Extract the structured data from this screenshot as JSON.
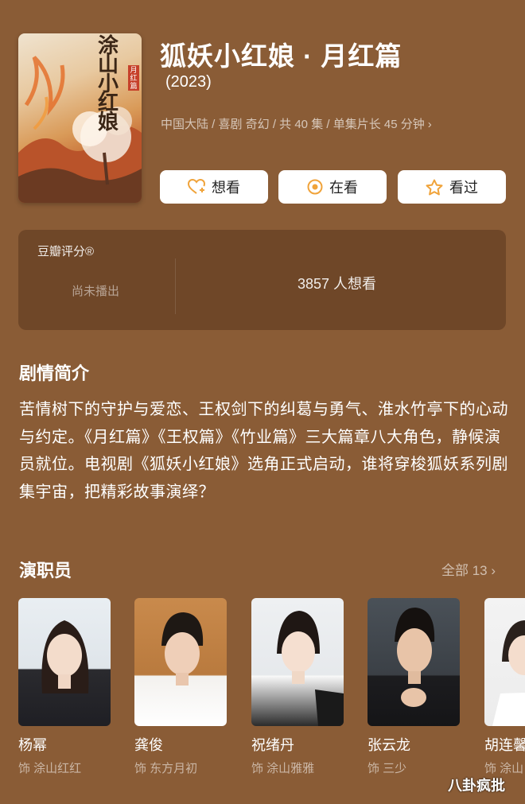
{
  "poster": {
    "calligraphy": "涂山小红娘",
    "seal": "月红篇"
  },
  "header": {
    "title": "狐妖小红娘 · 月红篇",
    "year": "(2023)",
    "meta": "中国大陆 / 喜剧 奇幻 / 共 40 集 / 单集片长 45 分钟"
  },
  "actions": {
    "want_label": "想看",
    "watching_label": "在看",
    "watched_label": "看过"
  },
  "rating": {
    "title": "豆瓣评分®",
    "status": "尚未播出",
    "want_count": "3857 人想看"
  },
  "synopsis": {
    "heading": "剧情简介",
    "text": "苦情树下的守护与爱恋、王权剑下的纠葛与勇气、淮水竹亭下的心动与约定。《月红篇》《王权篇》《竹业篇》三大篇章八大角色，静候演员就位。电视剧《狐妖小红娘》选角正式启动，谁将穿梭狐妖系列剧集宇宙，把精彩故事演绎？"
  },
  "cast": {
    "heading": "演职员",
    "all_label": "全部 13",
    "members": [
      {
        "name": "杨幂",
        "role": "饰 涂山红红"
      },
      {
        "name": "龚俊",
        "role": "饰 东方月初"
      },
      {
        "name": "祝绪丹",
        "role": "饰 涂山雅雅"
      },
      {
        "name": "张云龙",
        "role": "饰 三少"
      },
      {
        "name": "胡连馨",
        "role": "饰 涂山"
      }
    ]
  },
  "watermark": "八卦疯批",
  "colors": {
    "background": "#8a5c36",
    "accent_orange": "#f0a33a"
  }
}
